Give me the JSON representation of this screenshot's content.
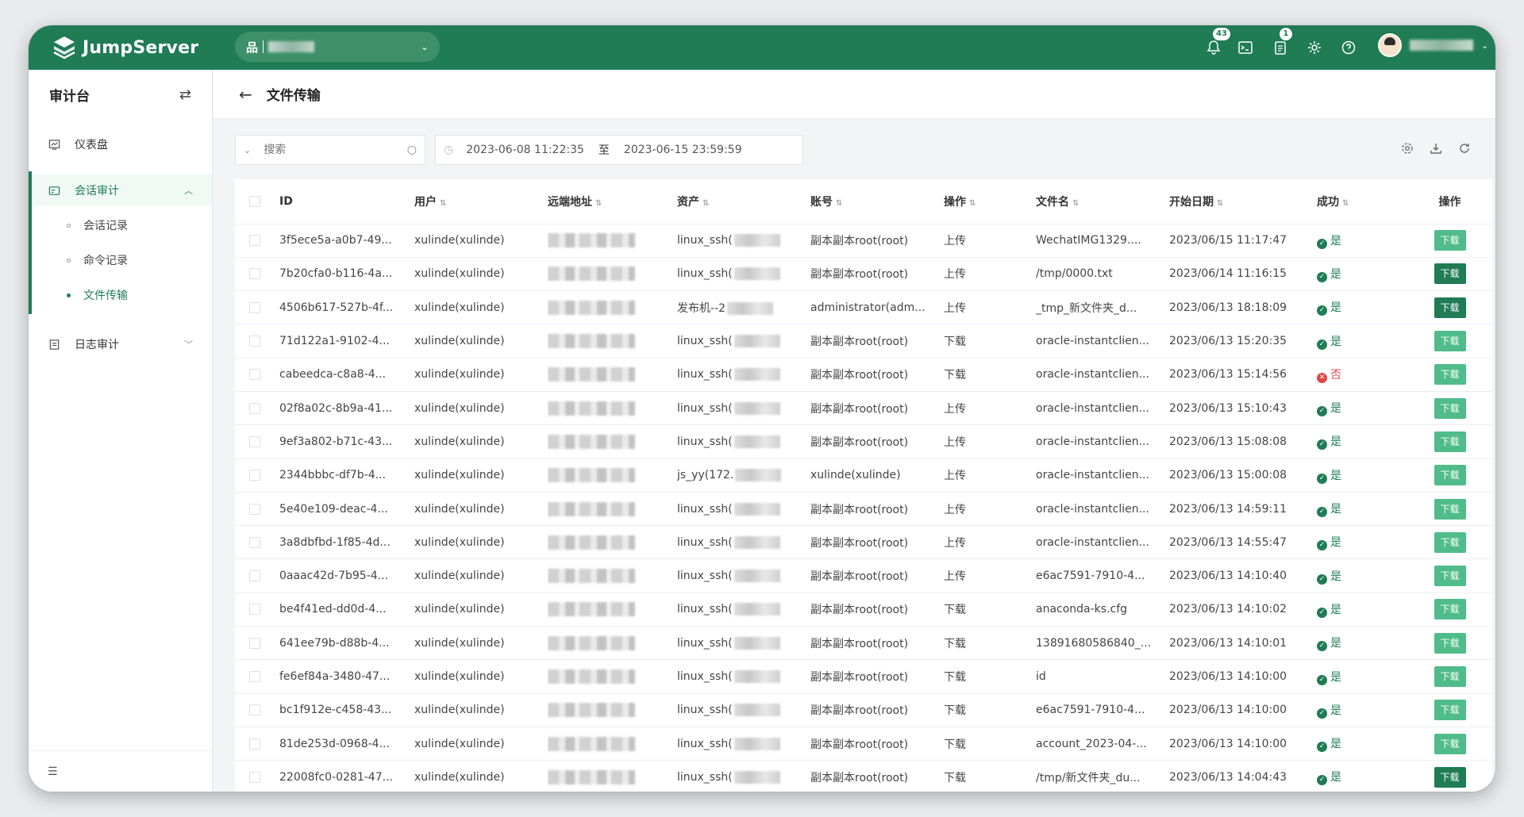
{
  "app": {
    "brand": "JumpServer",
    "org_icon": "品"
  },
  "header": {
    "notification_count": "43",
    "ticket_count": "1",
    "icons": [
      "bell-icon",
      "terminal-icon",
      "ticket-icon",
      "settings-icon",
      "help-icon"
    ]
  },
  "sidebar": {
    "title": "审计台",
    "items": [
      {
        "label": "仪表盘",
        "icon": "dashboard-icon"
      },
      {
        "label": "会话审计",
        "icon": "session-audit-icon",
        "children": [
          "会话记录",
          "命令记录",
          "文件传输"
        ]
      },
      {
        "label": "日志审计",
        "icon": "log-audit-icon"
      }
    ],
    "active_child": "文件传输"
  },
  "page": {
    "title": "文件传输"
  },
  "toolbar": {
    "search_placeholder": "搜索",
    "date_from": "2023-06-08 11:22:35",
    "date_to": "2023-06-15 23:59:59",
    "date_sep": "至"
  },
  "table": {
    "columns": [
      "ID",
      "用户",
      "远端地址",
      "资产",
      "账号",
      "操作",
      "文件名",
      "开始日期",
      "成功",
      "操作"
    ],
    "download_label": "下载",
    "rows": [
      {
        "id": "3f5ece5a-a0b7-49...",
        "user": "xulinde(xulinde)",
        "asset": "linux_ssh(",
        "account": "副本副本root(root)",
        "op": "上传",
        "file": "WechatIMG1329....",
        "date": "2023/06/15 11:17:47",
        "success": "是",
        "ok": true
      },
      {
        "id": "7b20cfa0-b116-4a...",
        "user": "xulinde(xulinde)",
        "asset": "linux_ssh(",
        "account": "副本副本root(root)",
        "op": "上传",
        "file": "/tmp/0000.txt",
        "date": "2023/06/14 11:16:15",
        "success": "是",
        "ok": true
      },
      {
        "id": "4506b617-527b-4f...",
        "user": "xulinde(xulinde)",
        "asset": "发布机--2",
        "account": "administrator(adm...",
        "op": "上传",
        "file": "_tmp_新文件夹_d...",
        "date": "2023/06/13 18:18:09",
        "success": "是",
        "ok": true
      },
      {
        "id": "71d122a1-9102-4...",
        "user": "xulinde(xulinde)",
        "asset": "linux_ssh(",
        "account": "副本副本root(root)",
        "op": "下载",
        "file": "oracle-instantclien...",
        "date": "2023/06/13 15:20:35",
        "success": "是",
        "ok": true
      },
      {
        "id": "cabeedca-c8a8-4...",
        "user": "xulinde(xulinde)",
        "asset": "linux_ssh(",
        "account": "副本副本root(root)",
        "op": "下载",
        "file": "oracle-instantclien...",
        "date": "2023/06/13 15:14:56",
        "success": "否",
        "ok": false
      },
      {
        "id": "02f8a02c-8b9a-41...",
        "user": "xulinde(xulinde)",
        "asset": "linux_ssh(",
        "account": "副本副本root(root)",
        "op": "上传",
        "file": "oracle-instantclien...",
        "date": "2023/06/13 15:10:43",
        "success": "是",
        "ok": true
      },
      {
        "id": "9ef3a802-b71c-43...",
        "user": "xulinde(xulinde)",
        "asset": "linux_ssh(",
        "account": "副本副本root(root)",
        "op": "上传",
        "file": "oracle-instantclien...",
        "date": "2023/06/13 15:08:08",
        "success": "是",
        "ok": true
      },
      {
        "id": "2344bbbc-df7b-4...",
        "user": "xulinde(xulinde)",
        "asset": "js_yy(172.",
        "account": "xulinde(xulinde)",
        "op": "上传",
        "file": "oracle-instantclien...",
        "date": "2023/06/13 15:00:08",
        "success": "是",
        "ok": true
      },
      {
        "id": "5e40e109-deac-4...",
        "user": "xulinde(xulinde)",
        "asset": "linux_ssh(",
        "account": "副本副本root(root)",
        "op": "上传",
        "file": "oracle-instantclien...",
        "date": "2023/06/13 14:59:11",
        "success": "是",
        "ok": true
      },
      {
        "id": "3a8dbfbd-1f85-4d...",
        "user": "xulinde(xulinde)",
        "asset": "linux_ssh(",
        "account": "副本副本root(root)",
        "op": "上传",
        "file": "oracle-instantclien...",
        "date": "2023/06/13 14:55:47",
        "success": "是",
        "ok": true
      },
      {
        "id": "0aaac42d-7b95-4...",
        "user": "xulinde(xulinde)",
        "asset": "linux_ssh(",
        "account": "副本副本root(root)",
        "op": "上传",
        "file": "e6ac7591-7910-4...",
        "date": "2023/06/13 14:10:40",
        "success": "是",
        "ok": true
      },
      {
        "id": "be4f41ed-dd0d-4...",
        "user": "xulinde(xulinde)",
        "asset": "linux_ssh(",
        "account": "副本副本root(root)",
        "op": "下载",
        "file": "anaconda-ks.cfg",
        "date": "2023/06/13 14:10:02",
        "success": "是",
        "ok": true
      },
      {
        "id": "641ee79b-d88b-4...",
        "user": "xulinde(xulinde)",
        "asset": "linux_ssh(",
        "account": "副本副本root(root)",
        "op": "下载",
        "file": "13891680586840_...",
        "date": "2023/06/13 14:10:01",
        "success": "是",
        "ok": true
      },
      {
        "id": "fe6ef84a-3480-47...",
        "user": "xulinde(xulinde)",
        "asset": "linux_ssh(",
        "account": "副本副本root(root)",
        "op": "下载",
        "file": "id",
        "date": "2023/06/13 14:10:00",
        "success": "是",
        "ok": true
      },
      {
        "id": "bc1f912e-c458-43...",
        "user": "xulinde(xulinde)",
        "asset": "linux_ssh(",
        "account": "副本副本root(root)",
        "op": "下载",
        "file": "e6ac7591-7910-4...",
        "date": "2023/06/13 14:10:00",
        "success": "是",
        "ok": true
      },
      {
        "id": "81de253d-0968-4...",
        "user": "xulinde(xulinde)",
        "asset": "linux_ssh(",
        "account": "副本副本root(root)",
        "op": "下载",
        "file": "account_2023-04-...",
        "date": "2023/06/13 14:10:00",
        "success": "是",
        "ok": true
      },
      {
        "id": "22008fc0-0281-47...",
        "user": "xulinde(xulinde)",
        "asset": "linux_ssh(",
        "account": "副本副本root(root)",
        "op": "下载",
        "file": "/tmp/新文件夹_du...",
        "date": "2023/06/13 14:04:43",
        "success": "是",
        "ok": true
      }
    ]
  },
  "colors": {
    "brand": "#1f7c55",
    "fail": "#e04848",
    "download": "#4fbc8a"
  }
}
